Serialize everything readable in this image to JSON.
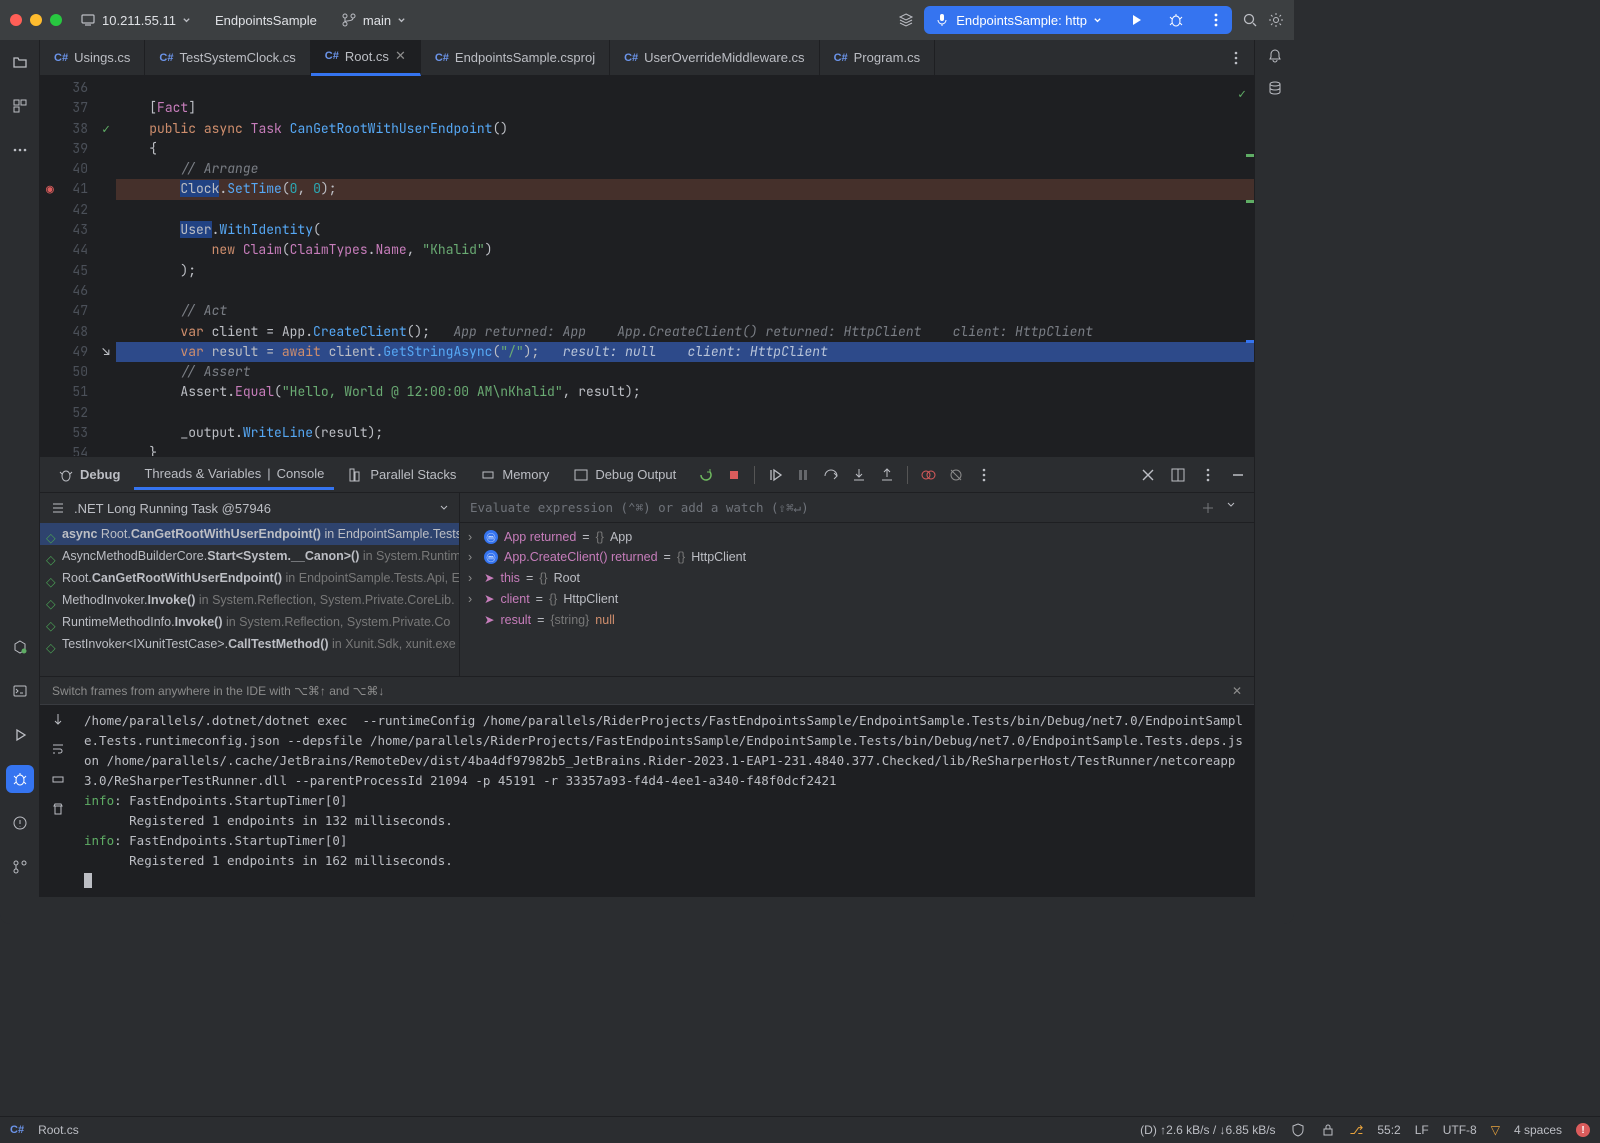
{
  "titlebar": {
    "host": "10.211.55.11",
    "project": "EndpointsSample",
    "branch": "main",
    "run_config": "EndpointsSample: http"
  },
  "tabs": [
    {
      "label": "Usings.cs",
      "active": false
    },
    {
      "label": "TestSystemClock.cs",
      "active": false
    },
    {
      "label": "Root.cs",
      "active": true
    },
    {
      "label": "EndpointsSample.csproj",
      "active": false
    },
    {
      "label": "UserOverrideMiddleware.cs",
      "active": false
    },
    {
      "label": "Program.cs",
      "active": false
    }
  ],
  "editor": {
    "first_line": 36,
    "lines": [
      {
        "n": 36,
        "html": ""
      },
      {
        "n": 37,
        "html": "    [<span class='ty'>Fact</span>]"
      },
      {
        "n": 38,
        "html": "    <span class='kw'>public</span> <span class='kw'>async</span> <span class='ty'>Task</span> <span class='fn'>CanGetRootWithUserEndpoint</span>()",
        "mark": "green-check-gutter"
      },
      {
        "n": 39,
        "html": "    {"
      },
      {
        "n": 40,
        "html": "        <span class='cm'>// Arrange</span>"
      },
      {
        "n": 41,
        "html": "        <span class='sel-bg'>Clock</span>.<span class='fn'>SetTime</span>(<span class='num'>0</span>, <span class='num'>0</span>);",
        "cls": "hl-red",
        "mark": "bp"
      },
      {
        "n": 42,
        "html": ""
      },
      {
        "n": 43,
        "html": "        <span class='sel-bg'>User</span>.<span class='fn'>WithIdentity</span>("
      },
      {
        "n": 44,
        "html": "            <span class='kw'>new</span> <span class='ty'>Claim</span>(<span class='ty'>ClaimTypes</span>.<span class='ty'>Name</span>, <span class='str'>\"Khalid\"</span>)"
      },
      {
        "n": 45,
        "html": "        );"
      },
      {
        "n": 46,
        "html": ""
      },
      {
        "n": 47,
        "html": "        <span class='cm'>// Act</span>"
      },
      {
        "n": 48,
        "html": "        <span class='kw'>var</span> client = App.<span class='fn'>CreateClient</span>();   <span class='inlay'>App returned: App    App.CreateClient() returned: HttpClient    client: HttpClient</span>"
      },
      {
        "n": 49,
        "html": "        <span class='kw'>var</span> result = <span class='kw'>await</span> client.<span class='fn'>GetStringAsync</span>(<span class='str'>\"/\"</span>);   <span class='inlay' style='color:#b8c4d9'>result: null    client: HttpClient</span>",
        "cls": "hl-blue",
        "mark": "arrow"
      },
      {
        "n": 50,
        "html": "        <span class='cm'>// Assert</span>"
      },
      {
        "n": 51,
        "html": "        Assert.<span class='ty'>Equal</span>(<span class='str'>\"Hello, World @ 12:00:00 AM\\nKhalid\"</span>, result);"
      },
      {
        "n": 52,
        "html": ""
      },
      {
        "n": 53,
        "html": "        _output.<span class='fn'>WriteLine</span>(result);"
      },
      {
        "n": 54,
        "html": "    }"
      }
    ]
  },
  "debug": {
    "title": "Debug",
    "tabs": [
      "Threads & Variables",
      "Console"
    ],
    "tabs2": [
      {
        "l": "Parallel Stacks"
      },
      {
        "l": "Memory"
      },
      {
        "l": "Debug Output"
      }
    ],
    "task": ".NET Long Running Task @57946",
    "vars_placeholder": "Evaluate expression (⌃⌘) or add a watch (⇧⌘↵)",
    "frames": [
      {
        "sel": true,
        "html": "<b>async</b> Root.<b>CanGetRootWithUserEndpoint()</b> in EndpointSample.Tests."
      },
      {
        "html": "AsyncMethodBuilderCore.<b>Start&lt;System.__Canon&gt;()</b> <span class='dim'>in System.Runtim</span>"
      },
      {
        "html": "Root.<b>CanGetRootWithUserEndpoint()</b> <span class='dim'>in EndpointSample.Tests.Api, Er</span>"
      },
      {
        "html": "MethodInvoker.<b>Invoke()</b> <span class='dim'>in System.Reflection, System.Private.CoreLib.</span>"
      },
      {
        "html": "RuntimeMethodInfo.<b>Invoke()</b> <span class='dim'>in System.Reflection, System.Private.Co</span>"
      },
      {
        "html": "TestInvoker&lt;IXunitTestCase&gt;.<b>CallTestMethod()</b> <span class='dim'>in Xunit.Sdk, xunit.exe</span>"
      }
    ],
    "vars": [
      {
        "arrow": true,
        "ic": "m",
        "nm": "App returned",
        "val": "{} App"
      },
      {
        "arrow": true,
        "ic": "m",
        "nm": "App.CreateClient() returned",
        "val": "{} HttpClient"
      },
      {
        "arrow": true,
        "ic": "p",
        "nm": "this",
        "val": "{} Root"
      },
      {
        "arrow": true,
        "ic": "p",
        "nm": "client",
        "val": "{} HttpClient"
      },
      {
        "arrow": false,
        "ic": "p",
        "nm": "result",
        "val": "{string} null",
        "null": true
      }
    ],
    "hint": "Switch frames from anywhere in the IDE with ⌥⌘↑ and ⌥⌘↓"
  },
  "console_text": "/home/parallels/.dotnet/dotnet exec  --runtimeConfig /home/parallels/RiderProjects/FastEndpointsSample/EndpointSample.Tests/bin/Debug/net7.0/EndpointSample.Tests.runtimeconfig.json --depsfile /home/parallels/RiderProjects/FastEndpointsSample/EndpointSample.Tests/bin/Debug/net7.0/EndpointSample.Tests.deps.json /home/parallels/.cache/JetBrains/RemoteDev/dist/4ba4df97982b5_JetBrains.Rider-2023.1-EAP1-231.4840.377.Checked/lib/ReSharperHost/TestRunner/netcoreapp3.0/ReSharperTestRunner.dll --parentProcessId 21094 -p 45191 -r 33357a93-f4d4-4ee1-a340-f48f0dcf2421",
  "console_lines": [
    {
      "p": "info",
      "t": ": FastEndpoints.StartupTimer[0]"
    },
    {
      "p": "",
      "t": "      Registered 1 endpoints in 132 milliseconds."
    },
    {
      "p": "info",
      "t": ": FastEndpoints.StartupTimer[0]"
    },
    {
      "p": "",
      "t": "      Registered 1 endpoints in 162 milliseconds."
    }
  ],
  "status": {
    "file": "Root.cs",
    "net": "(D) ↑2.6 kB/s / ↓6.85 kB/s",
    "pos": "55:2",
    "eol": "LF",
    "enc": "UTF-8",
    "indent": "4 spaces"
  }
}
